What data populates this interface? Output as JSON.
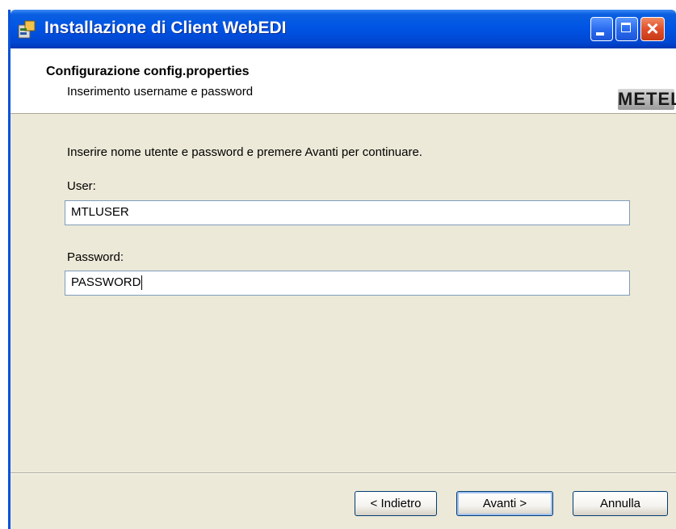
{
  "window": {
    "title": "Installazione di Client WebEDI"
  },
  "header": {
    "title": "Configurazione config.properties",
    "subtitle": "Inserimento username e password",
    "logo_text": "METEL"
  },
  "form": {
    "instructions": "Inserire nome utente e password e premere Avanti per continuare.",
    "user_label": "User:",
    "user_value": "MTLUSER",
    "password_label": "Password:",
    "password_value": "PASSWORD"
  },
  "buttons": {
    "back": "< Indietro",
    "next": "Avanti >",
    "cancel": "Annulla"
  }
}
